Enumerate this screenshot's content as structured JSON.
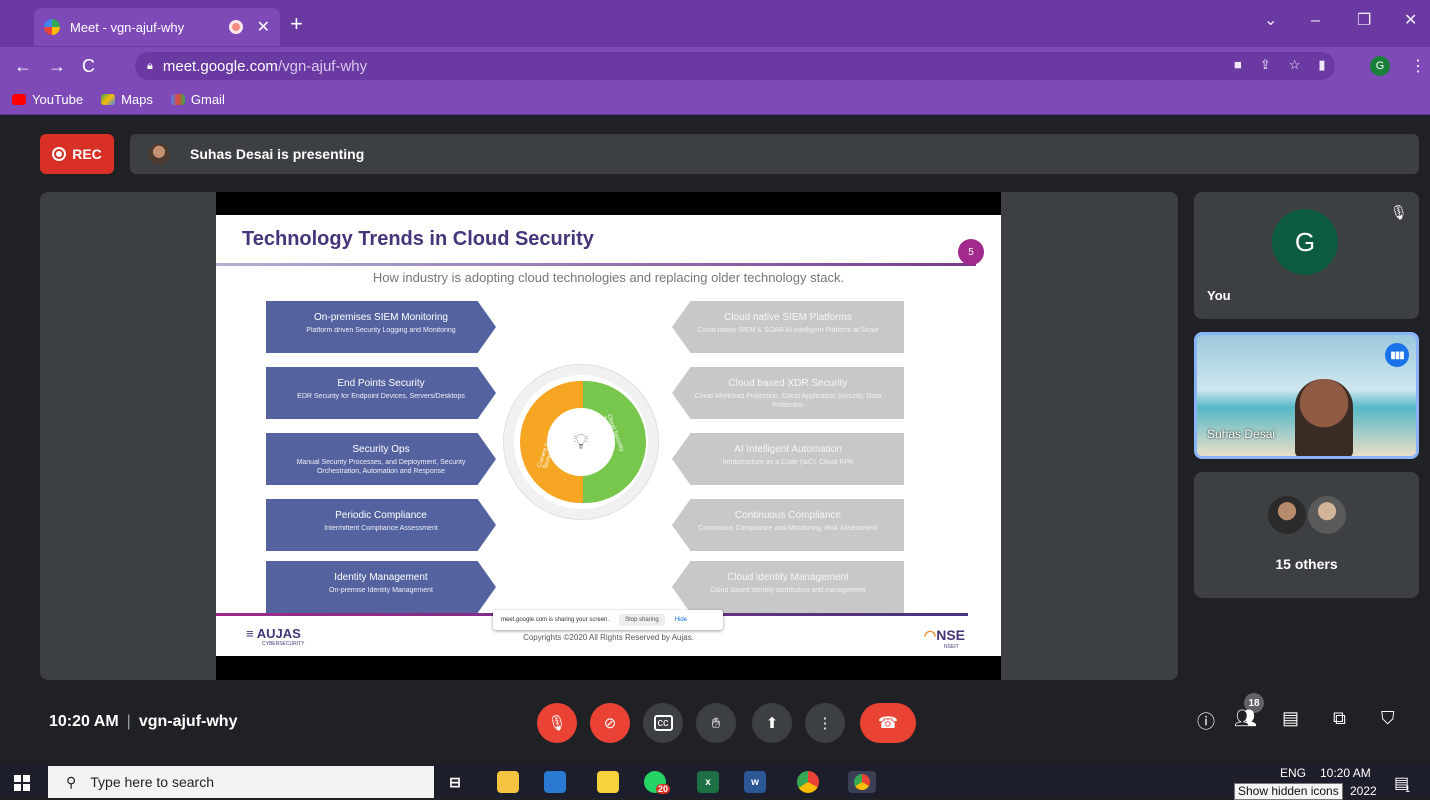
{
  "browser": {
    "tab_title": "Meet - vgn-ajuf-why",
    "tab_close": "✕",
    "new_tab": "+",
    "window_controls": [
      "⌄",
      "–",
      "❐",
      "✕"
    ],
    "url_domain": "meet.google.com",
    "url_path": "/vgn-ajuf-why",
    "profile_initial": "G",
    "bookmarks": [
      "YouTube",
      "Maps",
      "Gmail"
    ]
  },
  "meet": {
    "rec_label": "REC",
    "presenting_text": "Suhas Desai is presenting",
    "time": "10:20 AM",
    "separator": "|",
    "meeting_code": "vgn-ajuf-why",
    "participant_count": "18"
  },
  "slide": {
    "title": "Technology Trends in Cloud Security",
    "page_number": "5",
    "subtitle": "How industry is adopting cloud technologies and replacing older technology stack.",
    "left_items": [
      {
        "head": "On-premises SIEM Monitoring",
        "desc": "Platform driven Security Logging and Monitoring"
      },
      {
        "head": "End Points Security",
        "desc": "EDR Security for Endpoint Devices, Servers/Desktops"
      },
      {
        "head": "Security Ops",
        "desc": "Manual Security Processes, and Deployment, Security Orchestration, Automation and Response"
      },
      {
        "head": "Periodic Compliance",
        "desc": "Intermittent Compliance Assessment"
      },
      {
        "head": "Identity Management",
        "desc": "On-premise Identity Management"
      }
    ],
    "right_items": [
      {
        "head": "Cloud native SIEM Platforms",
        "desc": "Cloud native SIEM & SOAR AI intelligent Platform at Scale"
      },
      {
        "head": "Cloud based XDR Security",
        "desc": "Cloud Workload Protection, Cloud Application Security, Data Protection"
      },
      {
        "head": "AI Intelligent Automation",
        "desc": "Infrastructure as a Code (IaC), Cloud RPA"
      },
      {
        "head": "Continuous Compliance",
        "desc": "Continuous Compliance and Monitoring, Risk Assessment"
      },
      {
        "head": "Cloud identity Management",
        "desc": "Cloud based identity distribution and management"
      }
    ],
    "circle_left_label": "Current Security Technologies",
    "circle_right_label": "Cloud Security Trends",
    "footer_logo_left": "AUJAS",
    "footer_logo_left_sub": "CYBERSECURITY",
    "copyright": "Copyrights ©2020 All Rights Reserved by Aujas.",
    "footer_logo_right": "NSE",
    "footer_logo_right_sub": "NSEIT"
  },
  "share_pill": {
    "text": "meet.google.com is sharing your screen.",
    "stop": "Stop sharing",
    "hide": "Hide"
  },
  "participants": {
    "you_initial": "G",
    "you_label": "You",
    "presenter_name": "Suhas Desai",
    "others_label": "15 others"
  },
  "taskbar": {
    "search_placeholder": "Type here to search",
    "whatsapp_badge": "20",
    "lang": "ENG",
    "time": "10:20 AM",
    "date_partial": "2022",
    "tooltip": "Show hidden icons",
    "notif_count": "1"
  },
  "colors": {
    "chrome_tab": "#6a3aa2",
    "chrome_toolbar": "#7d4ab8",
    "meet_bg": "#202124",
    "tile_bg": "#3c4043",
    "danger": "#ea4335",
    "accent": "#8ab4f8"
  }
}
